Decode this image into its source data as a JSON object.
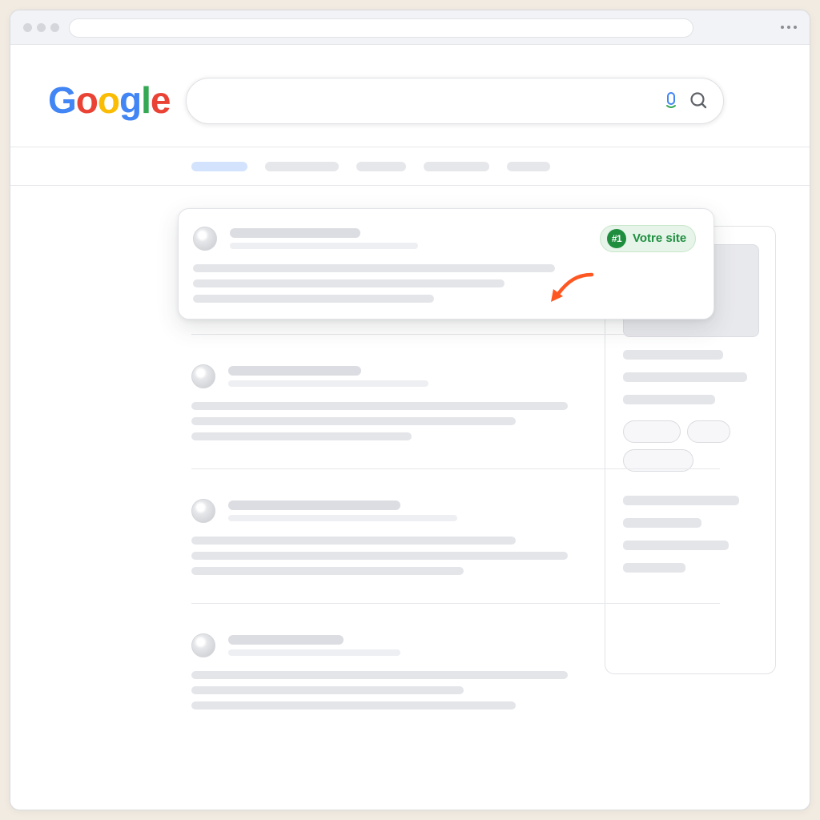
{
  "logo": {
    "letters": [
      "G",
      "o",
      "o",
      "g",
      "l",
      "e"
    ],
    "colors": [
      "#4285F4",
      "#EA4335",
      "#FBBC05",
      "#4285F4",
      "#34A853",
      "#EA4335"
    ]
  },
  "search": {
    "value": "",
    "icons": {
      "mic": "mic-icon",
      "search": "search-icon"
    }
  },
  "browser": {
    "menu_icon": "more-icon"
  },
  "highlight": {
    "rank": "#1",
    "label": "Votre site",
    "accent_color": "#1e8e3e",
    "arrow_color": "#ff5722",
    "arrow_icon": "curved-arrow-icon"
  },
  "colors": {
    "page_background": "#f1ebe2",
    "active_tab": "#d3e3fd",
    "placeholder": "#e4e5e9"
  }
}
